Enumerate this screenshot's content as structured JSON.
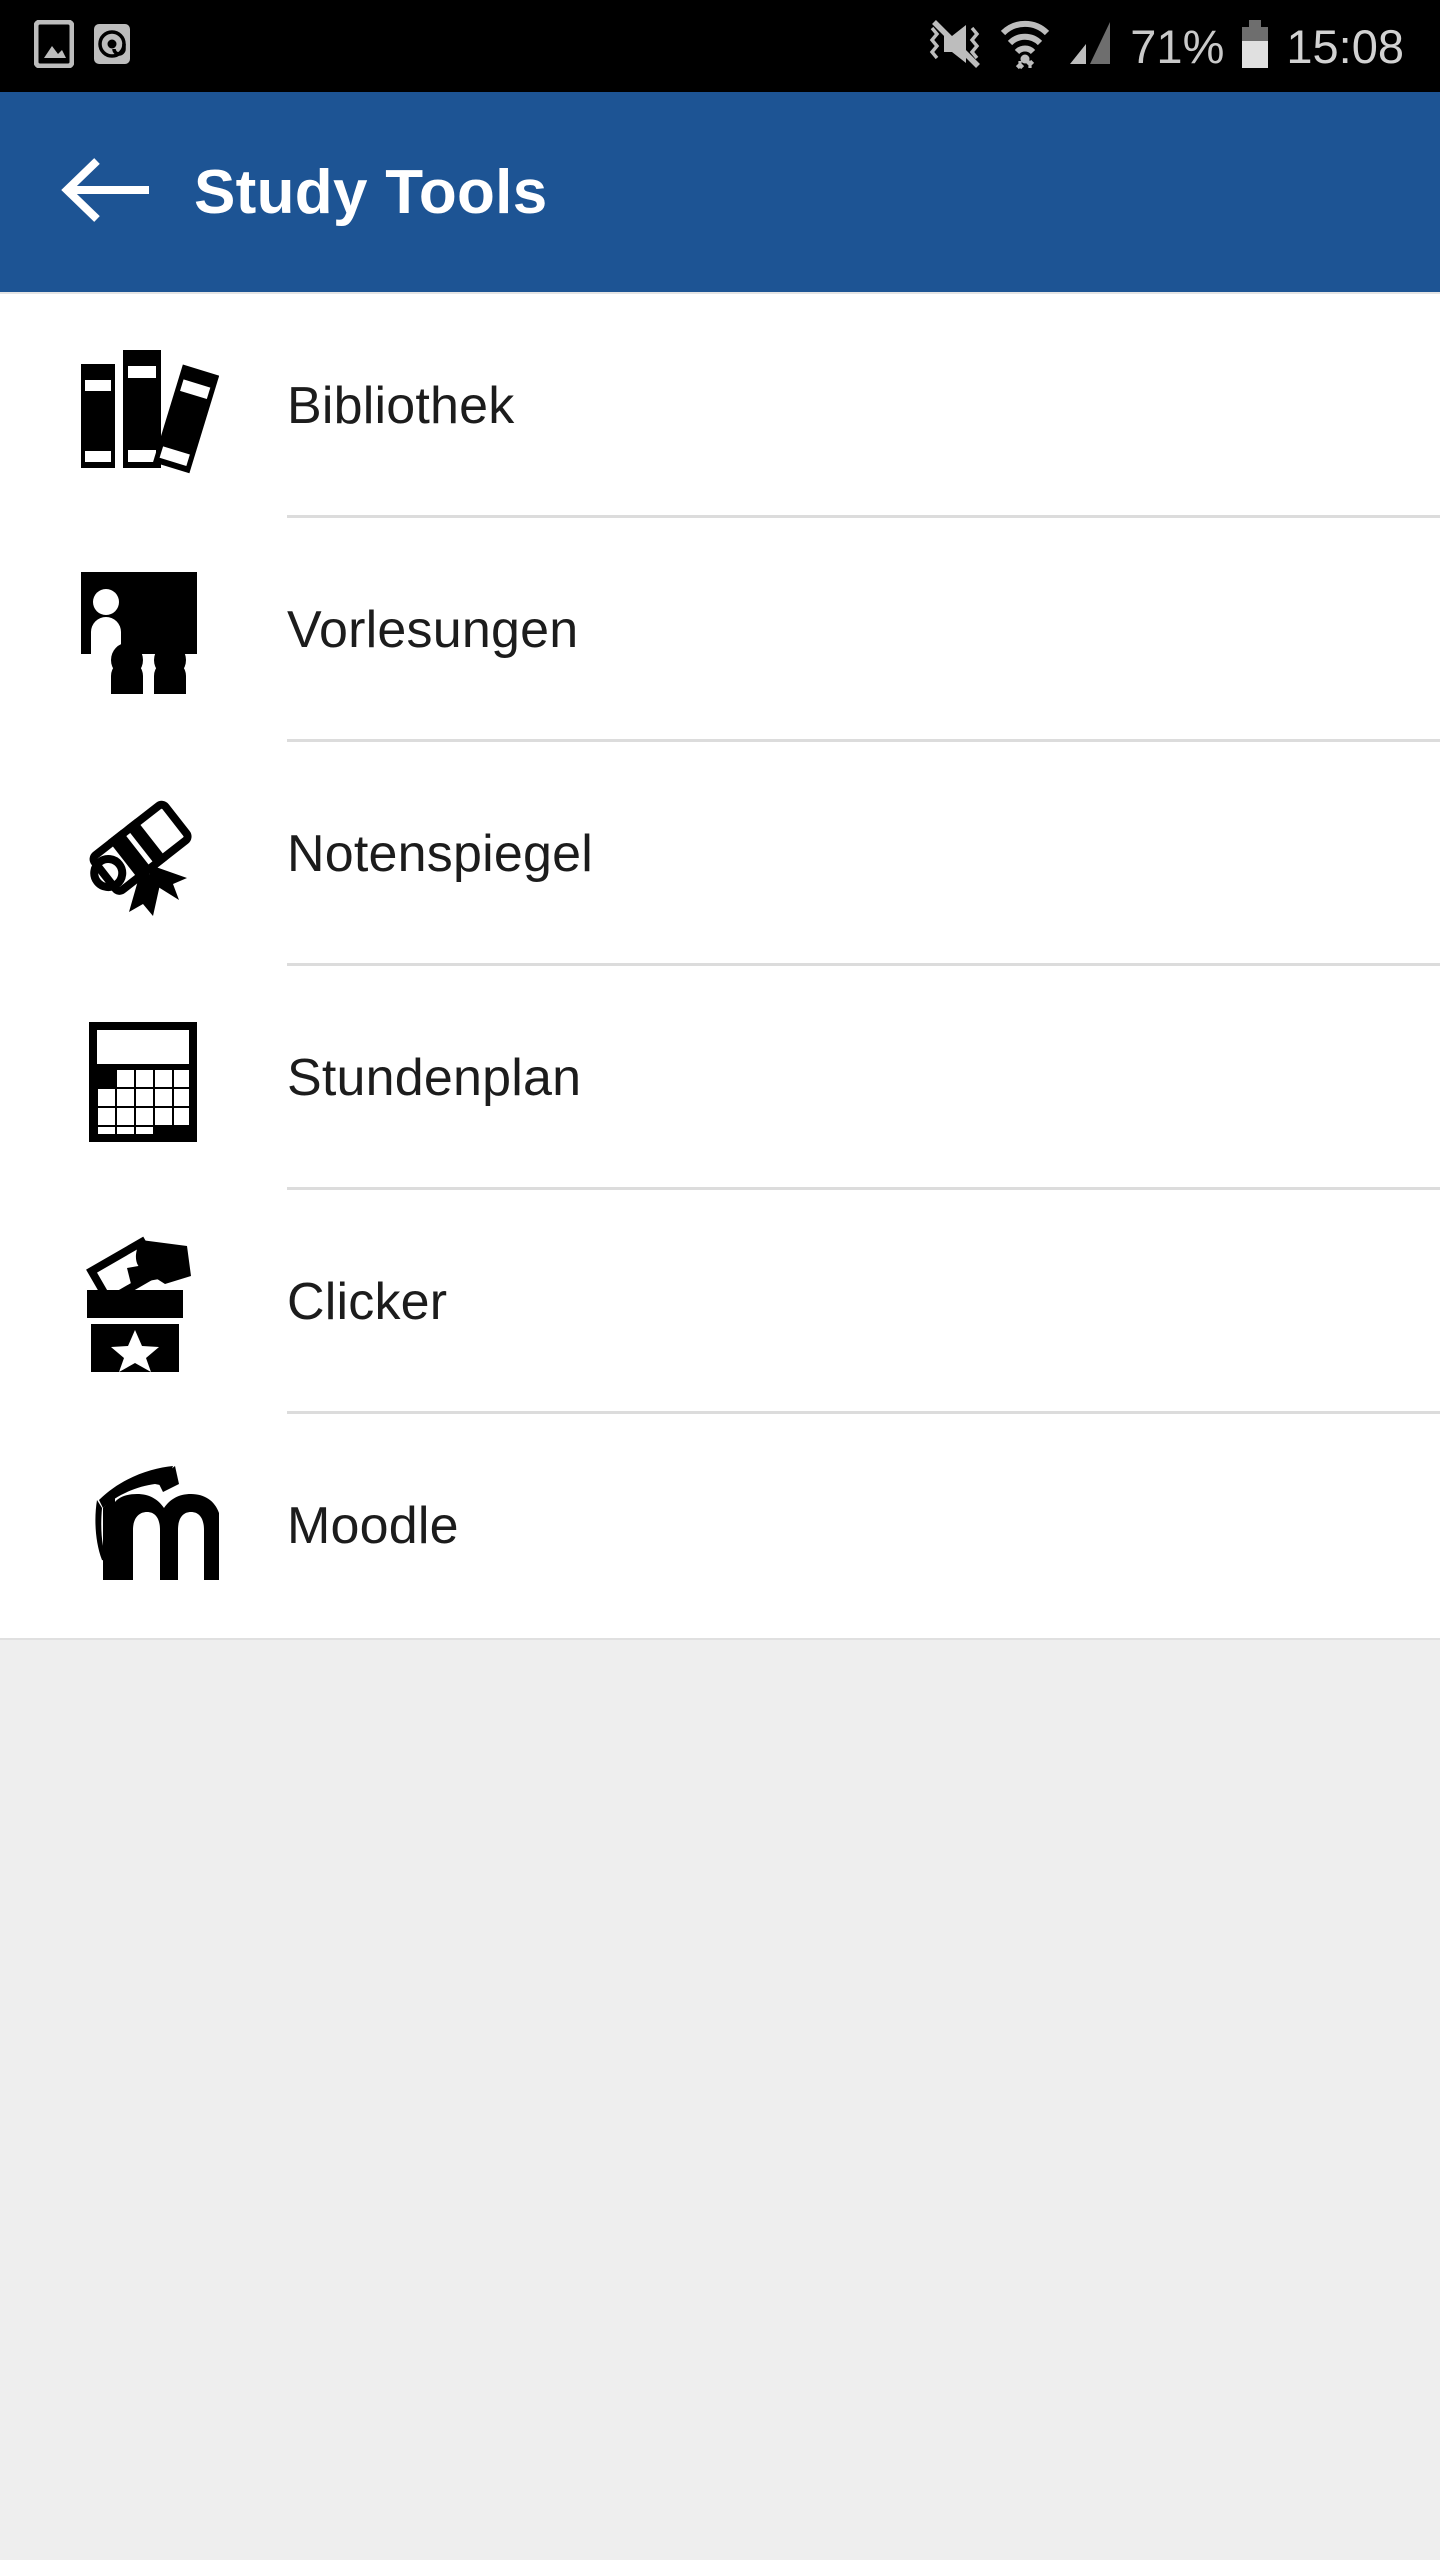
{
  "statusbar": {
    "left_icons": [
      {
        "name": "screenshot-image-icon",
        "label": "image"
      },
      {
        "name": "email-at-icon",
        "label": "@"
      }
    ],
    "right_icons": [
      {
        "name": "vibrate-mute-icon",
        "label": "mute"
      },
      {
        "name": "wifi-icon",
        "label": "wifi"
      },
      {
        "name": "cellular-signal-icon",
        "label": "signal"
      }
    ],
    "battery_percent": "71%",
    "battery_icon": "battery-icon",
    "clock": "15:08"
  },
  "appbar": {
    "back_icon": "back-arrow-icon",
    "title": "Study Tools",
    "background_color": "#1d5494",
    "text_color": "#ffffff"
  },
  "list": {
    "items": [
      {
        "label": "Bibliothek",
        "icon": "books-icon"
      },
      {
        "label": "Vorlesungen",
        "icon": "lecture-icon"
      },
      {
        "label": "Notenspiegel",
        "icon": "diploma-scroll-icon"
      },
      {
        "label": "Stundenplan",
        "icon": "calendar-icon"
      },
      {
        "label": "Clicker",
        "icon": "ballot-box-icon"
      },
      {
        "label": "Moodle",
        "icon": "moodle-logo-icon"
      }
    ]
  },
  "colors": {
    "accent": "#1d5494",
    "statusbar": "#000000",
    "page_background": "#eeeeee",
    "list_background": "#ffffff",
    "divider": "#dcdcdc",
    "label_text": "#1c1c1c"
  }
}
